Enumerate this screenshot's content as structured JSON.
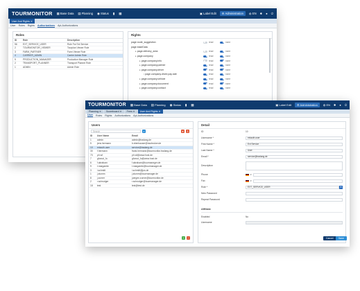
{
  "colors": {
    "topbar": "#0f3b6e",
    "accent": "#1e5aa0",
    "success": "#4caf50",
    "danger": "#e05a3a"
  },
  "back": {
    "brand": "TOURMONITOR",
    "nav": [
      {
        "label": "Base Data",
        "icon": "database-icon"
      },
      {
        "label": "Planning",
        "icon": "calendar-icon"
      },
      {
        "label": "Status",
        "icon": "status-icon"
      },
      {
        "label": "",
        "icon": "chart-icon"
      },
      {
        "label": "",
        "icon": "grid-icon"
      }
    ],
    "label_edit": "Label Edit",
    "admin": "Administration",
    "lang": "EN",
    "subtab": "User And Rights",
    "tabs": [
      "User",
      "Roles",
      "Rights",
      "Authorizations",
      "Api-Authorizations"
    ],
    "roles": {
      "title": "Roles",
      "headers": [
        "ID",
        "Role",
        "Description"
      ],
      "rows": [
        [
          "56",
          "EXT_SERVICE_USER",
          "Role For Ext Service"
        ],
        [
          "2",
          "TOURMONITOR_VIEWER",
          "Tourplan Viewer Role"
        ],
        [
          "3",
          "FARM_PARTNER",
          "Farm Viewer Role"
        ],
        [
          "4",
          "CARRIER_ADMIN",
          "Carrier Admin Role"
        ],
        [
          "5",
          "PRODUCTION_MANAGER",
          "Production Manager Role"
        ],
        [
          "2",
          "TRANSPORT_PLANNER",
          "Transport Planner Role"
        ],
        [
          "1",
          "ADMIN",
          "Admin Role"
        ]
      ],
      "selected": 3
    },
    "rights": {
      "title": "Rights",
      "read": "read",
      "none": "none",
      "items": [
        {
          "label": "page.route_suggestion",
          "depth": 0,
          "read": false
        },
        {
          "label": "page.baseData",
          "depth": 0,
          "plain": true
        },
        {
          "label": "page.delivery_area",
          "depth": 1,
          "read": false
        },
        {
          "label": "page.company",
          "depth": 1,
          "read": true
        },
        {
          "label": "page.company.info",
          "depth": 2,
          "read": false
        },
        {
          "label": "page.company.partner",
          "depth": 2,
          "read": true
        },
        {
          "label": "page.company.driver",
          "depth": 2,
          "read": true
        },
        {
          "label": "page.company.driver.pay.rate",
          "depth": 3,
          "read": true
        },
        {
          "label": "page.company.vehicle",
          "depth": 2,
          "read": true
        },
        {
          "label": "page.company.document",
          "depth": 2,
          "read": true
        },
        {
          "label": "page.company.contact",
          "depth": 2,
          "read": true
        }
      ]
    }
  },
  "front": {
    "brand": "TOURMONITOR",
    "nav": [
      {
        "label": "Base Data",
        "icon": "database-icon"
      },
      {
        "label": "Planning",
        "icon": "calendar-icon"
      },
      {
        "label": "Status",
        "icon": "status-icon"
      },
      {
        "label": "",
        "icon": "chart-icon"
      },
      {
        "label": "",
        "icon": "grid-icon"
      }
    ],
    "label_edit": "Label Edit",
    "admin": "Administration",
    "lang": "EN",
    "subtabs": [
      "Planning",
      "Scoreboard",
      "Fees",
      "User And Rights"
    ],
    "tabs": [
      "User",
      "Roles",
      "Rights",
      "Authorizations",
      "Api-Authorizations"
    ],
    "users": {
      "title": "Users",
      "search_placeholder": "Search",
      "headers": [
        "ID",
        "User Name",
        "Email"
      ],
      "rows": [
        [
          "1",
          "admin",
          "admin@tradang.de"
        ],
        [
          "5",
          "jens.hermann",
          "b.eberhauser@tourbroker.de"
        ],
        [
          "10",
          "extauth.user",
          "service@tradang.de"
        ],
        [
          "30",
          "f.hermann",
          "frank.hermann@tourmonitor.tradang.de"
        ],
        [
          "70",
          "ph.wf",
          "ph.wf@www.host.de"
        ],
        [
          "7",
          "gfurcut_fu",
          "gfurcut_fu@www.host.de"
        ],
        [
          "6",
          "f.abraham",
          "f.abraham@tourmaneger.de"
        ],
        [
          "9",
          "t.margarete",
          "t.margarete@tourmanager.de"
        ],
        [
          "3",
          "i.schmitt",
          "i.schmitt@jus.de"
        ],
        [
          "1",
          "j.stumm",
          "j.stumm@tourmanager.de"
        ],
        [
          "8",
          "j.zurner",
          "juergen.zurner@tourmonitor.de"
        ],
        [
          "2",
          "r.schrodger",
          "r.schrodger@tourmanager.de"
        ],
        [
          "18",
          "test",
          "test@test.de"
        ]
      ],
      "selected": 2
    },
    "detail": {
      "title": "Detail",
      "fields": [
        {
          "label": "ID",
          "value": "10",
          "kind": "text"
        },
        {
          "label": "Username *",
          "value": "extauth.user",
          "kind": "input"
        },
        {
          "label": "First Name *",
          "value": "Ext Service",
          "kind": "input"
        },
        {
          "label": "Last Name *",
          "value": "User",
          "kind": "input"
        },
        {
          "label": "Email *",
          "value": "service@tradang.de",
          "kind": "input"
        },
        {
          "label": "Description",
          "value": "",
          "kind": "area"
        },
        {
          "label": "Phone",
          "value": "",
          "kind": "phone"
        },
        {
          "label": "Fax",
          "value": "",
          "kind": "phone"
        },
        {
          "label": "Role *",
          "value": "EXT_SERVICE_USER",
          "kind": "select"
        },
        {
          "label": "New Password",
          "value": "",
          "kind": "input"
        },
        {
          "label": "Repeat Password",
          "value": "",
          "kind": "input"
        }
      ],
      "section": "Affiliate",
      "enabled_label": "Enabled",
      "enabled_value": "No",
      "username_label": "Username",
      "cancel": "Cancel",
      "save": "Save"
    }
  }
}
